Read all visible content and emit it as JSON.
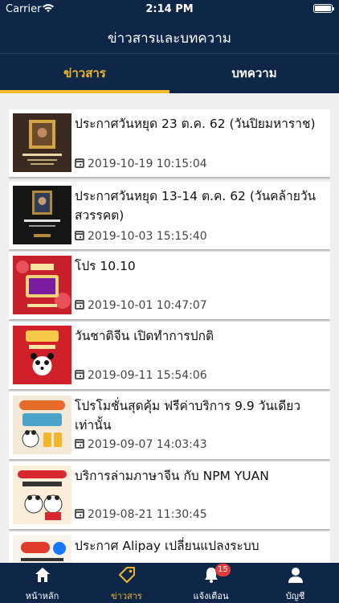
{
  "status_bar": {
    "carrier": "Carrier",
    "time": "2:14 PM"
  },
  "header": {
    "title": "ข่าวสารและบทความ"
  },
  "tabs": [
    {
      "label": "ข่าวสาร",
      "active": true
    },
    {
      "label": "บทความ",
      "active": false
    }
  ],
  "news": [
    {
      "title": "ประกาศวันหยุด 23 ต.ค. 62 (วันปิยมหาราช)",
      "date": "2019-10-19 10:15:04",
      "thumb_icon": "king-portrait-thumbnail"
    },
    {
      "title": "ประกาศวันหยุด 13-14 ต.ค. 62 (วันคล้ายวันสวรรคต)",
      "date": "2019-10-03 15:15:40",
      "thumb_icon": "memorial-portrait-thumbnail"
    },
    {
      "title": "โปร 10.10",
      "date": "2019-10-01 10:47:07",
      "thumb_icon": "promo-100-thumbnail"
    },
    {
      "title": "วันชาติจีน เปิดทำการปกติ",
      "date": "2019-09-11 15:54:06",
      "thumb_icon": "chinese-national-day-thumbnail"
    },
    {
      "title": "โปรโมชั่นสุดคุ้ม ฟรีค่าบริการ  9.9 วันเดียวเท่านั้น",
      "date": "2019-09-07 14:03:43",
      "thumb_icon": "promo-99-thumbnail"
    },
    {
      "title": "บริการล่ามภาษาจีน กับ NPM YUAN",
      "date": "2019-08-21 11:30:45",
      "thumb_icon": "interpreter-thumbnail"
    },
    {
      "title": "ประกาศ Alipay เปลี่ยนแปลงระบบ",
      "date": "",
      "thumb_icon": "alipay-announcement-thumbnail"
    }
  ],
  "tabbar": [
    {
      "label": "หน้าหลัก",
      "icon": "home-icon",
      "active": false
    },
    {
      "label": "ข่าวสาร",
      "icon": "tag-icon",
      "active": true
    },
    {
      "label": "แจ้งเตือน",
      "icon": "bell-icon",
      "active": false,
      "badge": "15"
    },
    {
      "label": "บัญชี",
      "icon": "user-icon",
      "active": false
    }
  ],
  "colors": {
    "navy": "#0e2748",
    "accent": "#f2b62a",
    "badge": "#e23b3b"
  }
}
